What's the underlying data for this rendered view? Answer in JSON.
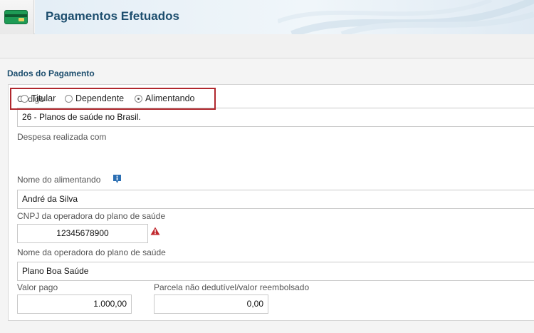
{
  "header": {
    "title": "Pagamentos Efetuados",
    "icon": "credit-card-icon"
  },
  "section": {
    "title": "Dados do Pagamento"
  },
  "form": {
    "codigo": {
      "label": "Código",
      "value": "26 - Planos de saúde no Brasil."
    },
    "despesa": {
      "label": "Despesa realizada com",
      "options": [
        {
          "label": "Titular",
          "checked": false
        },
        {
          "label": "Dependente",
          "checked": false
        },
        {
          "label": "Alimentando",
          "checked": true
        }
      ]
    },
    "nome_alimentando": {
      "label": "Nome do alimentando",
      "value": "André da Silva",
      "icon": "info-icon"
    },
    "cnpj": {
      "label": "CNPJ da operadora do plano de saúde",
      "value": "12345678900",
      "icon": "warning-icon"
    },
    "nome_operadora": {
      "label": "Nome da operadora do plano de saúde",
      "value": "Plano Boa Saúde"
    },
    "valor_pago": {
      "label": "Valor pago",
      "value": "1.000,00"
    },
    "parcela": {
      "label": "Parcela não dedutível/valor reembolsado",
      "value": "0,00"
    }
  },
  "colors": {
    "title": "#1d4e6e",
    "highlight_border": "#b0272d",
    "info_icon": "#2c6fb3",
    "warning_icon": "#c0282d",
    "card_icon": "#1e9b55"
  }
}
